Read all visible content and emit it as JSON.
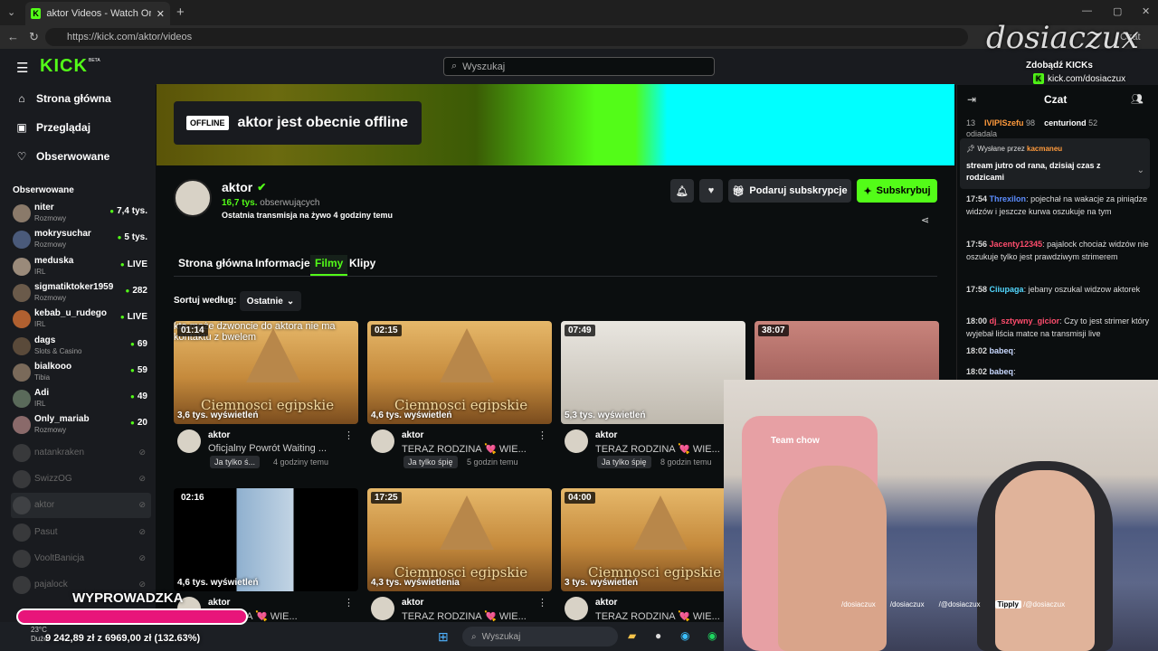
{
  "browser": {
    "tab_title": "aktor Videos - Watch On-Demand",
    "url": "https://kick.com/aktor/videos",
    "profile_label": "Czat"
  },
  "kick": {
    "logo": "KICK",
    "beta": "BETA",
    "search_placeholder": "Wyszukaj",
    "nav": [
      {
        "label": "Strona główna",
        "icon": "home-icon"
      },
      {
        "label": "Przeglądaj",
        "icon": "browse-icon"
      },
      {
        "label": "Obserwowane",
        "icon": "heart-icon"
      }
    ],
    "following_header": "Obserwowane",
    "following": [
      {
        "name": "niter",
        "category": "Rozmowy",
        "viewers": "7,4 tys."
      },
      {
        "name": "mokrysuchar",
        "category": "Rozmowy",
        "viewers": "5 tys."
      },
      {
        "name": "meduska",
        "category": "IRL",
        "viewers": "LIVE"
      },
      {
        "name": "sigmatiktoker1959",
        "category": "Rozmowy",
        "viewers": "282"
      },
      {
        "name": "kebab_u_rudego",
        "category": "IRL",
        "viewers": "LIVE"
      },
      {
        "name": "dags",
        "category": "Slots & Casino",
        "viewers": "69"
      },
      {
        "name": "bialkooo",
        "category": "Tibia",
        "viewers": "59"
      },
      {
        "name": "Adi",
        "category": "IRL",
        "viewers": "49"
      },
      {
        "name": "Only_mariab",
        "category": "Rozmowy",
        "viewers": "20"
      }
    ],
    "offline_following": [
      "natankraken",
      "SwizzOG",
      "aktor",
      "Pasut",
      "VooltBanicja",
      "pajalock"
    ],
    "offline_badge": "OFFLINE",
    "offline_text": "aktor jest obecnie offline",
    "channel": {
      "name": "aktor",
      "followers_count": "16,7 tys.",
      "followers_label": "obserwujących",
      "last_stream": "Ostatnia transmisja na żywo 4 godziny temu",
      "gift_button": "Podaruj subskrypcje",
      "subscribe_button": "Subskrybuj"
    },
    "tabs": [
      "Strona główna",
      "Informacje",
      "Filmy",
      "Klipy"
    ],
    "active_tab": "Filmy",
    "sort_label": "Sortuj według:",
    "sort_value": "Ostatnie",
    "videos": [
      {
        "duration": "01:14",
        "views": "3,6 tys. wyświetleń",
        "author": "aktor",
        "title": "Oficjalny Powrót Waiting ...",
        "tag": "Ja tylko ś...",
        "time": "4 godziny temu",
        "thumb_title": "Ciemnosci egipskie",
        "overlay_text": "kto może dzwoncie do aktora nie ma kontaktu z bwelem",
        "thumb": "egypt"
      },
      {
        "duration": "02:15",
        "views": "4,6 tys. wyświetleń",
        "author": "aktor",
        "title": "TERAZ RODZINA 💘 WIE...",
        "tag": "Ja tylko śpię",
        "time": "5 godzin temu",
        "thumb_title": "Ciemnosci egipskie",
        "thumb": "egypt"
      },
      {
        "duration": "07:49",
        "views": "5,3 tys. wyświetleń",
        "author": "aktor",
        "title": "TERAZ RODZINA 💘 WIE...",
        "tag": "Ja tylko śpię",
        "time": "8 godzin temu",
        "thumb": "room"
      },
      {
        "duration": "38:07",
        "thumb": "face"
      },
      {
        "duration": "02:16",
        "views": "4,6 tys. wyświetleń",
        "author": "aktor",
        "title": "RODZINA 💘 WIE...",
        "thumb": "dark"
      },
      {
        "duration": "17:25",
        "views": "4,3 tys. wyświetlenia",
        "author": "aktor",
        "title": "TERAZ RODZINA 💘 WIE...",
        "thumb_title": "Ciemnosci egipskie",
        "thumb": "egypt"
      },
      {
        "duration": "04:00",
        "views": "3 tys. wyświetleń",
        "author": "aktor",
        "title": "TERAZ RODZINA 💘 WIE...",
        "thumb_title": "Ciemnosci egipskie",
        "thumb": "egypt"
      }
    ],
    "chat": {
      "title": "Czat",
      "top_gifters": [
        {
          "rank": "13"
        },
        {
          "name": "IVIPISzefu",
          "count": "98"
        },
        {
          "name": "centuriond",
          "count": "52"
        }
      ],
      "pinned_by_label": "Wysłane przez",
      "pinned_by": "kacmaneu",
      "pinned_text": "stream jutro od rana, dzisiaj czas z rodzicami",
      "partial_top": "odiadala",
      "messages": [
        {
          "time": "17:54",
          "user": "Threxilon",
          "color": "#5c8dff",
          "text": "pojechał na wakacje za piniądze widzów i jeszcze kurwa oszukuje na tym"
        },
        {
          "time": "17:56",
          "user": "Jacenty12345",
          "color": "#ff4d6d",
          "text": "pajalock chociaż widzów nie oszukuje tylko jest prawdziwym strimerem"
        },
        {
          "time": "17:58",
          "user": "Ciiupaga",
          "color": "#53d8ff",
          "text": "jebany oszukal widzow aktorek"
        },
        {
          "time": "18:00",
          "user": "dj_sztywny_gicior",
          "color": "#ff4d6d",
          "text": "Czy to jest strimer który wyjebał liścia matce na transmisji live"
        },
        {
          "time": "18:02",
          "user": "babeq",
          "color": "#c8d8ff",
          "text": ""
        },
        {
          "time": "18:02",
          "user": "babeq",
          "color": "#c8d8ff",
          "text": ""
        }
      ]
    }
  },
  "overlay": {
    "streamer_logo": "dosiaczux",
    "kicks_label": "Zdobądź KICKs",
    "kick_link": "kick.com/dosiaczux",
    "goal_title": "WYPROWADZKA",
    "goal_amount": "9 242,89 zł z 6969,00 zł (132.63%)",
    "goal_progress": 1.0,
    "socials": [
      "/dosiaczux",
      "/dosiaczux",
      "/@dosiaczux",
      "/@dosiaczux"
    ],
    "tipply_label": "Tipply",
    "chair_text": "Team chow"
  },
  "taskbar": {
    "search_placeholder": "Wyszukaj",
    "weather_temp": "23°C",
    "weather_label": "Duże"
  },
  "colors": {
    "kick_green": "#53fc18",
    "goal_pink": "#e8157a"
  }
}
